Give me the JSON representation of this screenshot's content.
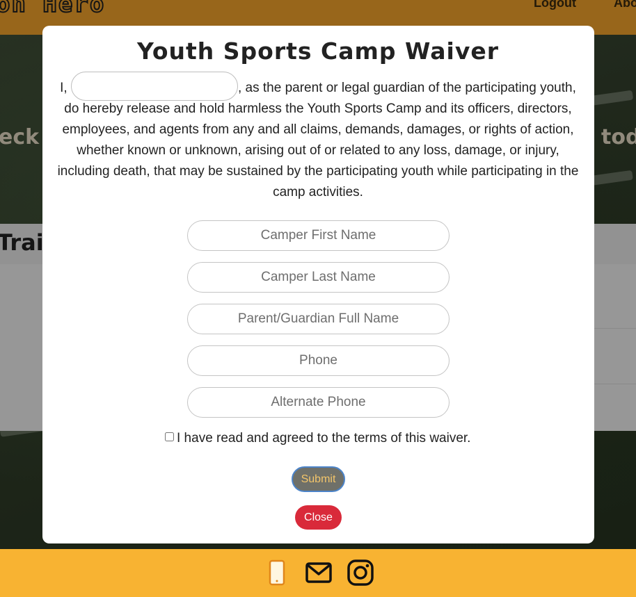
{
  "header": {
    "logo_text": "on Hero",
    "nav": [
      "Logout",
      "Abo"
    ]
  },
  "background": {
    "hero_left": "eck",
    "hero_right": "tod",
    "panel_title": "Trai"
  },
  "modal": {
    "title": "Youth Sports Camp Waiver",
    "intro_prefix": "I,",
    "intro_text": ", as the parent or legal guardian of the participating youth, do hereby release and hold harmless the Youth Sports Camp and its officers, directors, employees, and agents from any and all claims, demands, damages, or rights of action, whether known or unknown, arising out of or related to any loss, damage, or injury, including death, that may be sustained by the participating youth while participating in the camp activities.",
    "fields": {
      "inline_name": "",
      "camper_first": "Camper First Name",
      "camper_last": "Camper Last Name",
      "guardian": "Parent/Guardian Full Name",
      "phone": "Phone",
      "alt_phone": "Alternate Phone"
    },
    "agree_label": "I have read and agreed to the terms of this waiver.",
    "submit_label": "Submit",
    "close_label": "Close"
  },
  "footer": {
    "icons": [
      "phone-icon",
      "mail-icon",
      "instagram-icon"
    ]
  },
  "colors": {
    "header": "#f5a52c",
    "footer": "#f8b332",
    "close_button": "#d92a3a",
    "submit_button": "#6f7069",
    "submit_text": "#f3c56a"
  }
}
